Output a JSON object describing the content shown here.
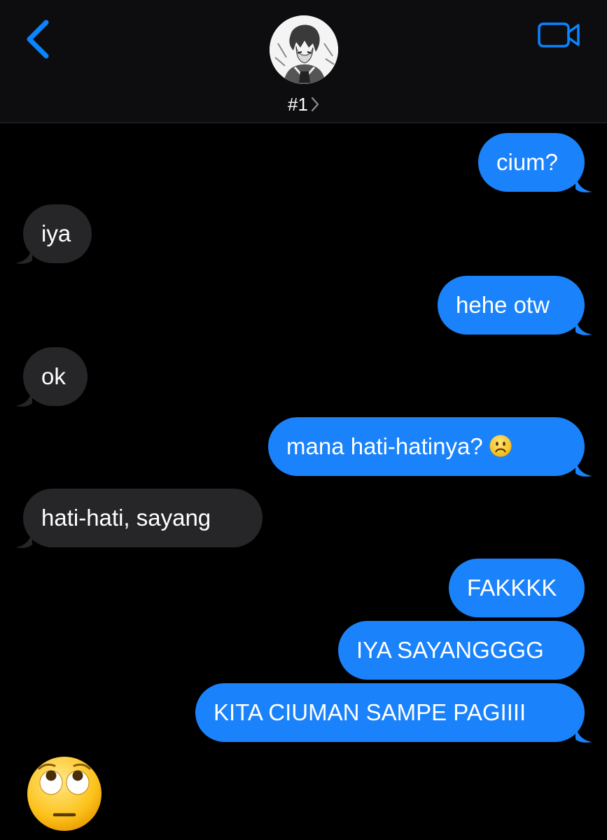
{
  "header": {
    "contact_name": "#1"
  },
  "messages": [
    {
      "from": "me",
      "text": "cium?"
    },
    {
      "from": "them",
      "text": "iya"
    },
    {
      "from": "me",
      "text": "hehe otw"
    },
    {
      "from": "them",
      "text": "ok"
    },
    {
      "from": "me",
      "text": "mana hati-hatinya?",
      "emoji": "frowning-face"
    },
    {
      "from": "them",
      "text": "hati-hati, sayang"
    },
    {
      "from": "me",
      "text": "FAKKKK"
    },
    {
      "from": "me",
      "text": "IYA SAYANGGGG"
    },
    {
      "from": "me",
      "text": "KITA CIUMAN SAMPE PAGIIII"
    },
    {
      "from": "them",
      "emoji": "face-with-rolling-eyes"
    }
  ],
  "colors": {
    "accent": "#0a84ff",
    "outgoing_bubble": "#1a82fb",
    "incoming_bubble": "#262629",
    "background": "#000000",
    "header_background": "#0d0d0f"
  }
}
